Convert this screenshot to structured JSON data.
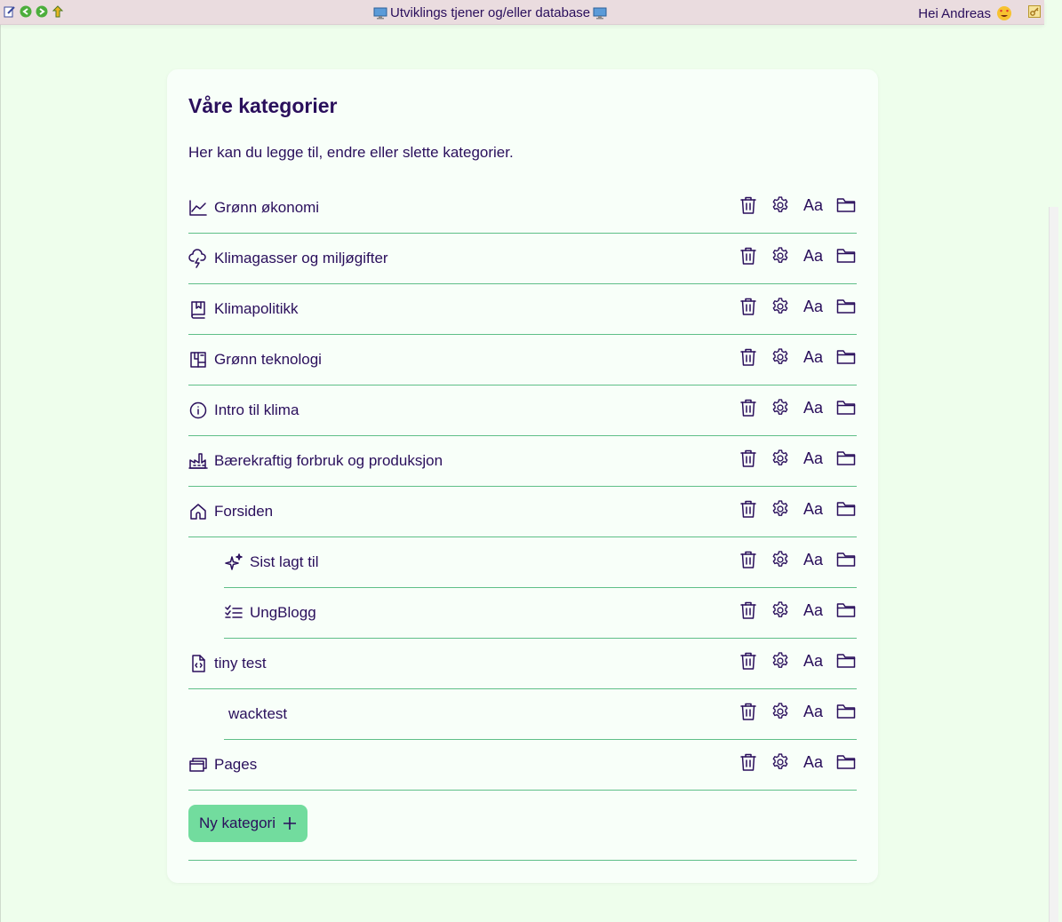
{
  "topbar": {
    "title": "Utviklings tjener og/eller database",
    "greeting": "Hei Andreas"
  },
  "page": {
    "title": "Våre kategorier",
    "description": "Her kan du legge til, endre eller slette kategorier."
  },
  "categories": [
    {
      "label": "Grønn økonomi",
      "icon": "chart-line-icon",
      "indent": false
    },
    {
      "label": "Klimagasser og miljøgifter",
      "icon": "cloud-lightning-icon",
      "indent": false
    },
    {
      "label": "Klimapolitikk",
      "icon": "book-bookmark-icon",
      "indent": false
    },
    {
      "label": "Grønn teknologi",
      "icon": "blueprint-icon",
      "indent": false
    },
    {
      "label": "Intro til klima",
      "icon": "info-icon",
      "indent": false
    },
    {
      "label": "Bærekraftig forbruk og produksjon",
      "icon": "factory-icon",
      "indent": false
    },
    {
      "label": "Forsiden",
      "icon": "home-icon",
      "indent": false
    },
    {
      "label": "Sist lagt til",
      "icon": "sparkles-icon",
      "indent": true
    },
    {
      "label": "UngBlogg",
      "icon": "list-check-icon",
      "indent": true
    },
    {
      "label": "tiny test",
      "icon": "file-code-icon",
      "indent": false
    },
    {
      "label": "wacktest",
      "icon": "",
      "indent": true
    },
    {
      "label": "Pages",
      "icon": "windows-stack-icon",
      "indent": false
    }
  ],
  "actions": {
    "font_label": "Aa"
  },
  "new_button": {
    "label": "Ny kategori"
  },
  "colors": {
    "background": "#eefeec",
    "card": "#f8fff9",
    "text": "#2a0f5c",
    "divider": "#5fbf88",
    "button": "#72dc9e",
    "topbar": "#eadcdf"
  }
}
